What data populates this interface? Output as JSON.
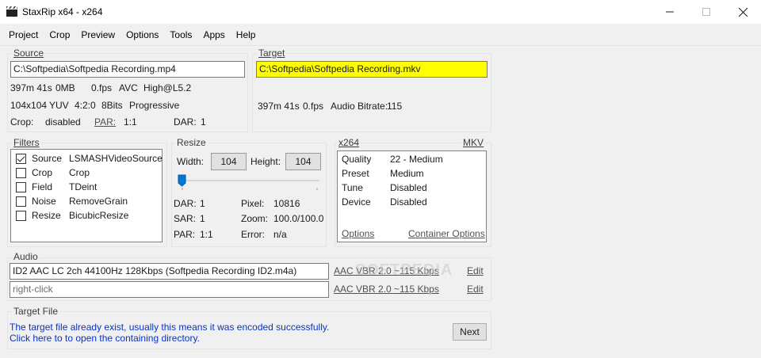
{
  "window": {
    "title": "StaxRip x64 - x264"
  },
  "menu": [
    "Project",
    "Crop",
    "Preview",
    "Options",
    "Tools",
    "Apps",
    "Help"
  ],
  "source": {
    "legend": "Source",
    "path": "C:\\Softpedia\\Softpedia Recording.mp4",
    "duration": "397m 41s",
    "size": "0MB",
    "fps": "0.fps",
    "codec": "AVC",
    "profile": "High@L5.2",
    "resolution": "104x104",
    "colorspace": "YUV",
    "chroma": "4:2:0",
    "bits": "8Bits",
    "scan": "Progressive",
    "crop_label": "Crop:",
    "crop_value": "disabled",
    "par_label": "PAR:",
    "par_value": "1:1",
    "dar_label": "DAR:",
    "dar_value": "1"
  },
  "target": {
    "legend": "Target",
    "path": "C:\\Softpedia\\Softpedia Recording.mkv",
    "duration": "397m 41s",
    "fps": "0.fps",
    "audio_bitrate_label": "Audio Bitrate:",
    "audio_bitrate_value": "115"
  },
  "filters": {
    "legend": "Filters",
    "items": [
      {
        "name": "Source",
        "value": "LSMASHVideoSource",
        "checked": true
      },
      {
        "name": "Crop",
        "value": "Crop",
        "checked": false
      },
      {
        "name": "Field",
        "value": "TDeint",
        "checked": false
      },
      {
        "name": "Noise",
        "value": "RemoveGrain",
        "checked": false
      },
      {
        "name": "Resize",
        "value": "BicubicResize",
        "checked": false
      }
    ]
  },
  "resize": {
    "legend": "Resize",
    "width_label": "Width:",
    "width_value": "104",
    "height_label": "Height:",
    "height_value": "104",
    "dar_label": "DAR:",
    "dar_value": "1",
    "pixel_label": "Pixel:",
    "pixel_value": "10816",
    "sar_label": "SAR:",
    "sar_value": "1",
    "zoom_label": "Zoom:",
    "zoom_value": "100.0/100.0",
    "par_label": "PAR:",
    "par_value": "1:1",
    "error_label": "Error:",
    "error_value": "n/a"
  },
  "encoder": {
    "legend": "x264",
    "container": "MKV",
    "rows": [
      {
        "key": "Quality",
        "value": "22 - Medium"
      },
      {
        "key": "Preset",
        "value": "Medium"
      },
      {
        "key": "Tune",
        "value": "Disabled"
      },
      {
        "key": "Device",
        "value": "Disabled"
      }
    ],
    "options_link": "Options",
    "container_options_link": "Container Options"
  },
  "audio": {
    "legend": "Audio",
    "tracks": [
      {
        "value": "ID2 AAC LC 2ch 44100Hz 128Kbps (Softpedia Recording ID2.m4a)",
        "profile": "AAC VBR 2.0 ~115 Kbps",
        "edit": "Edit"
      },
      {
        "value": "right-click",
        "profile": "AAC VBR 2.0 ~115 Kbps",
        "edit": "Edit"
      }
    ]
  },
  "target_file": {
    "legend": "Target File",
    "message_line1": "The target file already exist, usually this means it was encoded successfully.",
    "message_line2": "Click here to to open the containing directory.",
    "next_button": "Next"
  },
  "watermark": "SOFTPEDIA"
}
